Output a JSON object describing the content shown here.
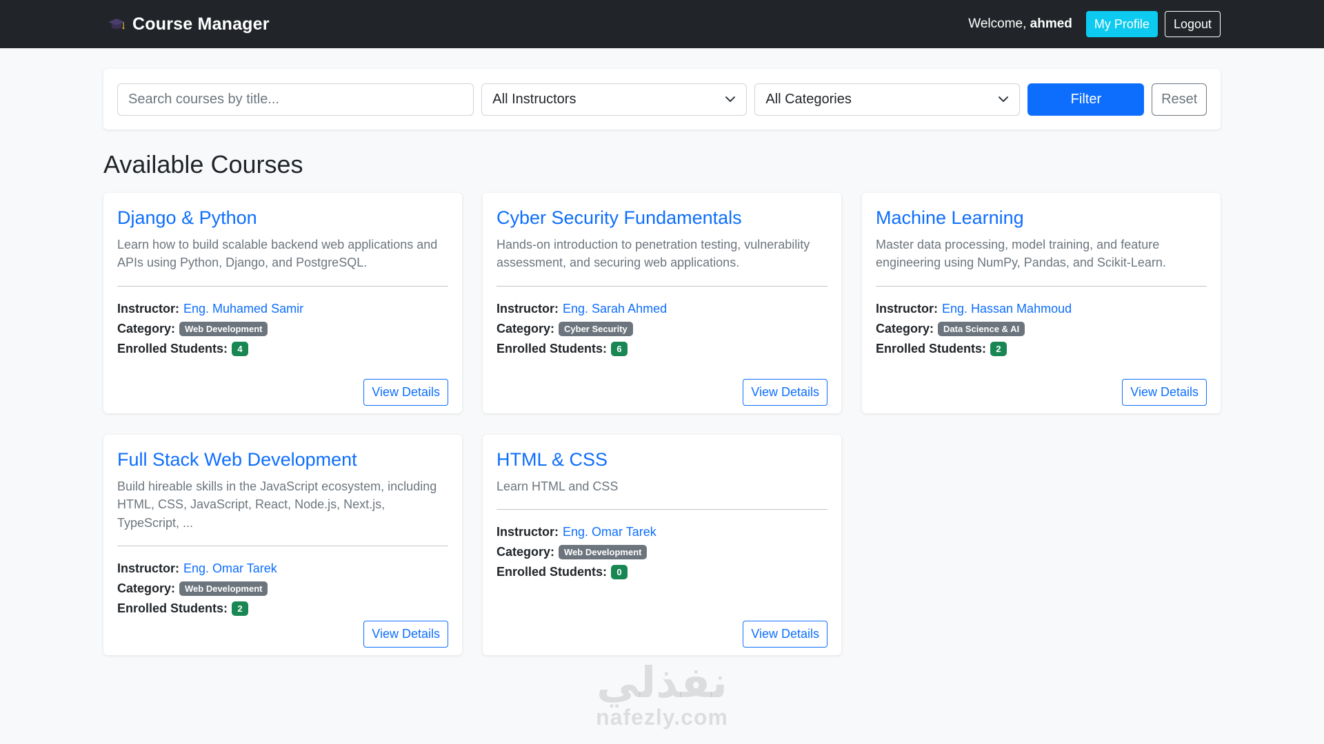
{
  "navbar": {
    "title": "Course Manager",
    "brand_icon": "graduation-cap-icon",
    "welcome_prefix": "Welcome,",
    "username": "ahmed",
    "profile_label": "My Profile",
    "logout_label": "Logout"
  },
  "filters": {
    "search_placeholder": "Search courses by title...",
    "instructor_selected": "All Instructors",
    "category_selected": "All Categories",
    "filter_label": "Filter",
    "reset_label": "Reset"
  },
  "page_title": "Available Courses",
  "labels": {
    "instructor": "Instructor:",
    "category": "Category:",
    "enrolled": "Enrolled Students:",
    "view_details": "View Details"
  },
  "courses": [
    {
      "title": "Django & Python",
      "description": "Learn how to build scalable backend web applications and APIs using Python, Django, and PostgreSQL.",
      "instructor": "Eng. Muhamed Samir",
      "category": "Web Development",
      "enrolled": "4"
    },
    {
      "title": "Cyber Security Fundamentals",
      "description": "Hands-on introduction to penetration testing, vulnerability assessment, and securing web applications.",
      "instructor": "Eng. Sarah Ahmed",
      "category": "Cyber Security",
      "enrolled": "6"
    },
    {
      "title": "Machine Learning",
      "description": "Master data processing, model training, and feature engineering using NumPy, Pandas, and Scikit-Learn.",
      "instructor": "Eng. Hassan Mahmoud",
      "category": "Data Science & AI",
      "enrolled": "2"
    },
    {
      "title": "Full Stack Web Development",
      "description": "Build hireable skills in the JavaScript ecosystem, including HTML, CSS, JavaScript, React, Node.js, Next.js, TypeScript, ...",
      "instructor": "Eng. Omar Tarek",
      "category": "Web Development",
      "enrolled": "2"
    },
    {
      "title": "HTML & CSS",
      "description": "Learn HTML and CSS",
      "instructor": "Eng. Omar Tarek",
      "category": "Web Development",
      "enrolled": "0"
    }
  ],
  "watermark": {
    "arabic": "نفذلي",
    "latin": "nafezly.com"
  },
  "colors": {
    "navbar_bg": "#212529",
    "primary": "#0d6efd",
    "info": "#0dcaf0",
    "secondary": "#6c757d",
    "success": "#198754"
  }
}
